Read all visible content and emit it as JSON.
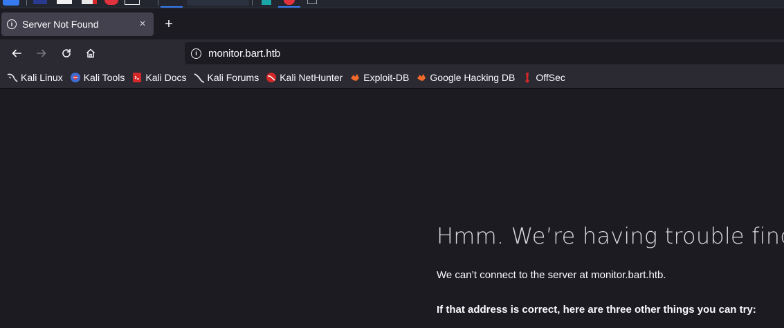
{
  "browser": {
    "tab": {
      "title": "Server Not Found",
      "close_glyph": "×",
      "icon": "info-icon"
    },
    "new_tab_glyph": "+",
    "nav": {
      "back_glyph": "←",
      "forward_glyph": "→",
      "reload_glyph": "↻",
      "home_glyph": "⌂"
    },
    "url": {
      "value": "monitor.bart.htb",
      "icon": "info-icon"
    },
    "bookmarks": [
      {
        "label": "Kali Linux",
        "icon": "kali-dragon-icon"
      },
      {
        "label": "Kali Tools",
        "icon": "kali-tools-icon"
      },
      {
        "label": "Kali Docs",
        "icon": "kali-docs-icon"
      },
      {
        "label": "Kali Forums",
        "icon": "kali-forums-icon"
      },
      {
        "label": "Kali NetHunter",
        "icon": "nethunter-icon"
      },
      {
        "label": "Exploit-DB",
        "icon": "exploit-db-icon"
      },
      {
        "label": "Google Hacking DB",
        "icon": "ghdb-icon"
      },
      {
        "label": "OffSec",
        "icon": "offsec-icon"
      }
    ]
  },
  "error_page": {
    "title": "Hmm. We’re having trouble finding that site.",
    "description": "We can’t connect to the server at monitor.bart.htb.",
    "try_heading": "If that address is correct, here are three other things you can try:"
  },
  "colors": {
    "page_bg": "#1c1b22",
    "toolbar_bg": "#2b2a33",
    "tab_bg": "#42414d",
    "accent": "#367bf0"
  }
}
